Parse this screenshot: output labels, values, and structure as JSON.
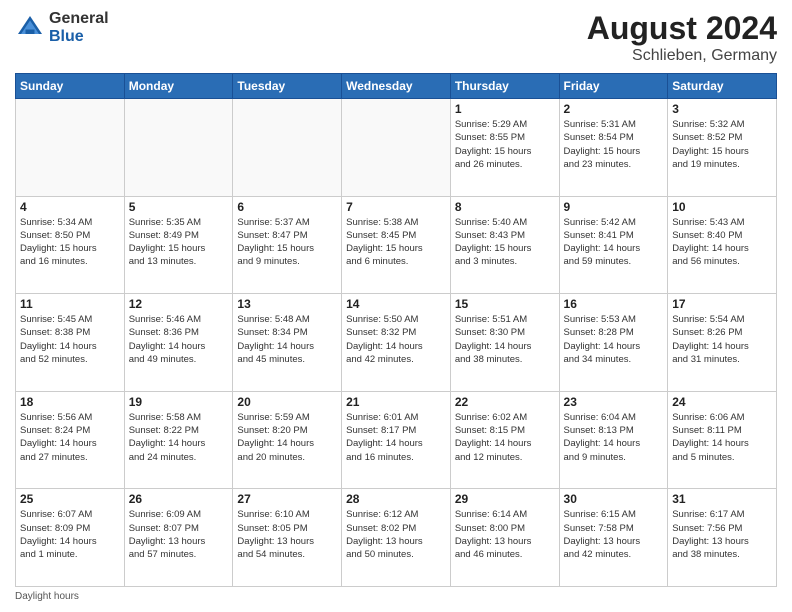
{
  "header": {
    "logo_general": "General",
    "logo_blue": "Blue",
    "month_year": "August 2024",
    "location": "Schlieben, Germany"
  },
  "days_of_week": [
    "Sunday",
    "Monday",
    "Tuesday",
    "Wednesday",
    "Thursday",
    "Friday",
    "Saturday"
  ],
  "footer": {
    "daylight_note": "Daylight hours"
  },
  "weeks": [
    [
      {
        "day": "",
        "info": ""
      },
      {
        "day": "",
        "info": ""
      },
      {
        "day": "",
        "info": ""
      },
      {
        "day": "",
        "info": ""
      },
      {
        "day": "1",
        "info": "Sunrise: 5:29 AM\nSunset: 8:55 PM\nDaylight: 15 hours\nand 26 minutes."
      },
      {
        "day": "2",
        "info": "Sunrise: 5:31 AM\nSunset: 8:54 PM\nDaylight: 15 hours\nand 23 minutes."
      },
      {
        "day": "3",
        "info": "Sunrise: 5:32 AM\nSunset: 8:52 PM\nDaylight: 15 hours\nand 19 minutes."
      }
    ],
    [
      {
        "day": "4",
        "info": "Sunrise: 5:34 AM\nSunset: 8:50 PM\nDaylight: 15 hours\nand 16 minutes."
      },
      {
        "day": "5",
        "info": "Sunrise: 5:35 AM\nSunset: 8:49 PM\nDaylight: 15 hours\nand 13 minutes."
      },
      {
        "day": "6",
        "info": "Sunrise: 5:37 AM\nSunset: 8:47 PM\nDaylight: 15 hours\nand 9 minutes."
      },
      {
        "day": "7",
        "info": "Sunrise: 5:38 AM\nSunset: 8:45 PM\nDaylight: 15 hours\nand 6 minutes."
      },
      {
        "day": "8",
        "info": "Sunrise: 5:40 AM\nSunset: 8:43 PM\nDaylight: 15 hours\nand 3 minutes."
      },
      {
        "day": "9",
        "info": "Sunrise: 5:42 AM\nSunset: 8:41 PM\nDaylight: 14 hours\nand 59 minutes."
      },
      {
        "day": "10",
        "info": "Sunrise: 5:43 AM\nSunset: 8:40 PM\nDaylight: 14 hours\nand 56 minutes."
      }
    ],
    [
      {
        "day": "11",
        "info": "Sunrise: 5:45 AM\nSunset: 8:38 PM\nDaylight: 14 hours\nand 52 minutes."
      },
      {
        "day": "12",
        "info": "Sunrise: 5:46 AM\nSunset: 8:36 PM\nDaylight: 14 hours\nand 49 minutes."
      },
      {
        "day": "13",
        "info": "Sunrise: 5:48 AM\nSunset: 8:34 PM\nDaylight: 14 hours\nand 45 minutes."
      },
      {
        "day": "14",
        "info": "Sunrise: 5:50 AM\nSunset: 8:32 PM\nDaylight: 14 hours\nand 42 minutes."
      },
      {
        "day": "15",
        "info": "Sunrise: 5:51 AM\nSunset: 8:30 PM\nDaylight: 14 hours\nand 38 minutes."
      },
      {
        "day": "16",
        "info": "Sunrise: 5:53 AM\nSunset: 8:28 PM\nDaylight: 14 hours\nand 34 minutes."
      },
      {
        "day": "17",
        "info": "Sunrise: 5:54 AM\nSunset: 8:26 PM\nDaylight: 14 hours\nand 31 minutes."
      }
    ],
    [
      {
        "day": "18",
        "info": "Sunrise: 5:56 AM\nSunset: 8:24 PM\nDaylight: 14 hours\nand 27 minutes."
      },
      {
        "day": "19",
        "info": "Sunrise: 5:58 AM\nSunset: 8:22 PM\nDaylight: 14 hours\nand 24 minutes."
      },
      {
        "day": "20",
        "info": "Sunrise: 5:59 AM\nSunset: 8:20 PM\nDaylight: 14 hours\nand 20 minutes."
      },
      {
        "day": "21",
        "info": "Sunrise: 6:01 AM\nSunset: 8:17 PM\nDaylight: 14 hours\nand 16 minutes."
      },
      {
        "day": "22",
        "info": "Sunrise: 6:02 AM\nSunset: 8:15 PM\nDaylight: 14 hours\nand 12 minutes."
      },
      {
        "day": "23",
        "info": "Sunrise: 6:04 AM\nSunset: 8:13 PM\nDaylight: 14 hours\nand 9 minutes."
      },
      {
        "day": "24",
        "info": "Sunrise: 6:06 AM\nSunset: 8:11 PM\nDaylight: 14 hours\nand 5 minutes."
      }
    ],
    [
      {
        "day": "25",
        "info": "Sunrise: 6:07 AM\nSunset: 8:09 PM\nDaylight: 14 hours\nand 1 minute."
      },
      {
        "day": "26",
        "info": "Sunrise: 6:09 AM\nSunset: 8:07 PM\nDaylight: 13 hours\nand 57 minutes."
      },
      {
        "day": "27",
        "info": "Sunrise: 6:10 AM\nSunset: 8:05 PM\nDaylight: 13 hours\nand 54 minutes."
      },
      {
        "day": "28",
        "info": "Sunrise: 6:12 AM\nSunset: 8:02 PM\nDaylight: 13 hours\nand 50 minutes."
      },
      {
        "day": "29",
        "info": "Sunrise: 6:14 AM\nSunset: 8:00 PM\nDaylight: 13 hours\nand 46 minutes."
      },
      {
        "day": "30",
        "info": "Sunrise: 6:15 AM\nSunset: 7:58 PM\nDaylight: 13 hours\nand 42 minutes."
      },
      {
        "day": "31",
        "info": "Sunrise: 6:17 AM\nSunset: 7:56 PM\nDaylight: 13 hours\nand 38 minutes."
      }
    ]
  ]
}
